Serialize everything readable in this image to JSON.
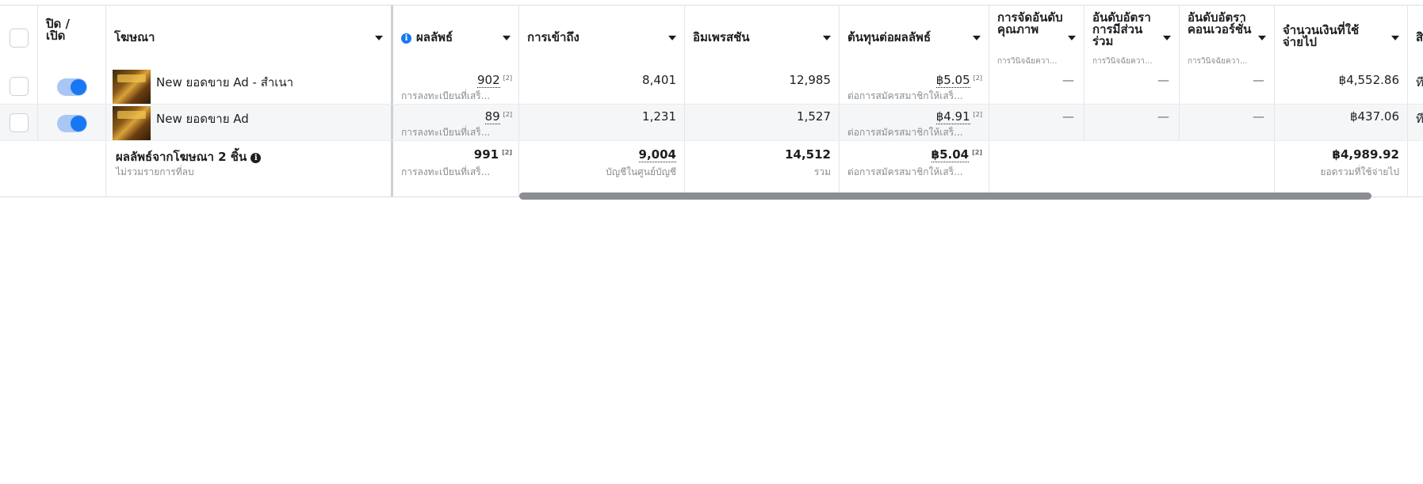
{
  "headers": {
    "toggle": "ปิด / เปิด",
    "ad": "โฆษณา",
    "results": "ผลลัพธ์",
    "reach": "การเข้าถึง",
    "impressions": "อิมเพรสชัน",
    "cost_per_result": "ต้นทุนต่อผลลัพธ์",
    "quality_ranking": "การจัดอันดับคุณภาพ",
    "quality_ranking_sub": "การวินิจฉัยควา...",
    "engagement_ranking": "อันดับอัตราการมีส่วนร่วม",
    "engagement_ranking_sub": "การวินิจฉัยควา...",
    "conversion_ranking": "อันดับอัตราคอนเวอร์ชั่น",
    "conversion_ranking_sub": "การวินิจฉัยควา...",
    "amount_spent": "จำนวนเงินที่ใช้จ่ายไป",
    "next_col": "สิ"
  },
  "rows": [
    {
      "name": "New ยอดขาย Ad - สำเนา",
      "results": "902",
      "results_sup": "[2]",
      "results_sub": "การลงทะเบียนที่เสร็...",
      "reach": "8,401",
      "impressions": "12,985",
      "cost_per_result": "฿5.05",
      "cost_sup": "[2]",
      "cost_sub": "ต่อการสมัครสมาชิกให้เสร็...",
      "quality": "—",
      "engagement": "—",
      "conversion": "—",
      "amount": "฿4,552.86",
      "next_col": "ที"
    },
    {
      "name": "New ยอดขาย Ad",
      "results": "89",
      "results_sup": "[2]",
      "results_sub": "การลงทะเบียนที่เสร็...",
      "reach": "1,231",
      "impressions": "1,527",
      "cost_per_result": "฿4.91",
      "cost_sup": "[2]",
      "cost_sub": "ต่อการสมัครสมาชิกให้เสร็...",
      "quality": "—",
      "engagement": "—",
      "conversion": "—",
      "amount": "฿437.06",
      "next_col": "ที"
    }
  ],
  "totals": {
    "title": "ผลลัพธ์จากโฆษณา 2 ชิ้น",
    "subtitle": "ไม่รวมรายการที่ลบ",
    "results": "991",
    "results_sup": "[2]",
    "results_sub": "การลงทะเบียนที่เสร็...",
    "reach": "9,004",
    "reach_sub": "บัญชีในศูนย์บัญชี",
    "impressions": "14,512",
    "impressions_sub": "รวม",
    "cost_per_result": "฿5.04",
    "cost_sup": "[2]",
    "cost_sub": "ต่อการสมัครสมาชิกให้เสร็...",
    "amount": "฿4,989.92",
    "amount_sub": "ยอดรวมที่ใช้จ่ายไป"
  },
  "colors": {
    "toggle_on": "#1877f2",
    "info_icon": "#1877f2"
  }
}
